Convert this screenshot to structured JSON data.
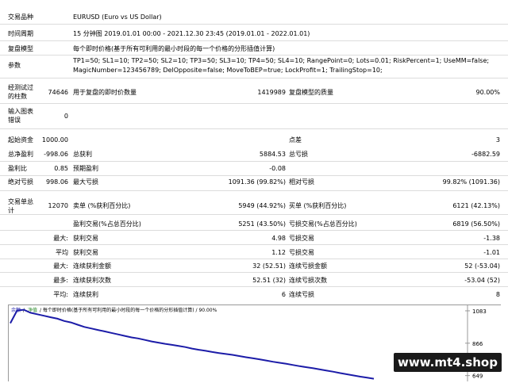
{
  "header": {
    "symbol_label": "交易品种",
    "symbol_value": "EURUSD (Euro vs US Dollar)",
    "period_label": "时间周期",
    "period_value": "15 分钟图 2019.01.01 00:00 - 2021.12.30 23:45 (2019.01.01 - 2022.01.01)",
    "model_label": "复盘模型",
    "model_value": "每个即时价格(基于所有可利用的最小时段的每一个价格的分形插值计算)",
    "params_label": "参数",
    "params_line1": "TP1=50; SL1=10; TP2=50; SL2=10; TP3=50; SL3=10; TP4=50; SL4=10; RangePoint=0; Lots=0.01; RiskPercent=1; UseMM=false;",
    "params_line2": "MagicNumber=123456789; DelOpposite=false; MoveToBEP=true; LockProfit=1; TrailingStop=10;"
  },
  "bars_section": {
    "bars_label_1": "经测试过",
    "bars_label_2": "的柱数",
    "bars_value": "74646",
    "ticks_label": "用于复盘的即时价数量",
    "ticks_value": "1419989",
    "quality_label": "复盘模型的质量",
    "quality_value": "90.00%",
    "errors_label_1": "输入图表",
    "errors_label_2": "错误",
    "errors_value": "0"
  },
  "money": {
    "deposit_label": "起始资金",
    "deposit_value": "1000.00",
    "spread_label": "点差",
    "spread_value": "3",
    "net_label": "总净盈利",
    "net_value": "-998.06",
    "gross_profit_label": "总获利",
    "gross_profit_value": "5884.53",
    "gross_loss_label": "总亏损",
    "gross_loss_value": "-6882.59",
    "pf_label": "盈利比",
    "pf_value": "0.85",
    "payoff_label": "预期盈利",
    "payoff_value": "-0.08",
    "abs_dd_label": "绝对亏损",
    "abs_dd_value": "998.06",
    "max_dd_label": "最大亏损",
    "max_dd_value": "1091.36 (99.82%)",
    "rel_dd_label": "相对亏损",
    "rel_dd_value": "99.82% (1091.36)"
  },
  "trades": {
    "total_label_1": "交易单总",
    "total_label_2": "计",
    "total_value": "12070",
    "short_label": "卖单 (%获利百分比)",
    "short_value": "5949 (44.92%)",
    "long_label": "买单 (%获利百分比)",
    "long_value": "6121 (42.13%)",
    "profit_trades_label": "盈利交易(%占总百分比)",
    "profit_trades_value": "5251 (43.50%)",
    "loss_trades_label": "亏损交易(%占总百分比)",
    "loss_trades_value": "6819 (56.50%)",
    "rows": [
      {
        "pre": "最大:",
        "l1": "获利交易",
        "v1": "4.98",
        "l2": "亏损交易",
        "v2": "-1.38"
      },
      {
        "pre": "平均",
        "l1": "获利交易",
        "v1": "1.12",
        "l2": "亏损交易",
        "v2": "-1.01"
      },
      {
        "pre": "最大:",
        "l1": "连续获利金额",
        "v1": "32 (52.51)",
        "l2": "连续亏损金额",
        "v2": "52 (-53.04)"
      },
      {
        "pre": "最多:",
        "l1": "连续获利次数",
        "v1": "52.51 (32)",
        "l2": "连续亏损次数",
        "v2": "-53.04 (52)"
      },
      {
        "pre": "平均:",
        "l1": "连续获利",
        "v1": "6",
        "l2": "连续亏损",
        "v2": "8"
      }
    ]
  },
  "chart": {
    "balance_label": "余额",
    "sep": "/",
    "equity_label": "净值",
    "model_note": "/ 每个即时价格(基于所有可利用的最小时段的每一个价格的分形插值计算) / 90.00%",
    "axis_ticks": [
      "1083",
      "866",
      "649"
    ],
    "line_color": "#1c1ca8"
  },
  "chart_data": {
    "type": "line",
    "title": "",
    "xlabel": "",
    "ylabel": "",
    "ylim": [
      610,
      1120
    ],
    "y_ticks": [
      1083,
      866,
      649
    ],
    "series": [
      {
        "values": [
          1000,
          1085,
          1090,
          1070,
          1060,
          1050,
          1040,
          1030,
          1015,
          1005,
          990,
          975,
          965,
          955,
          945,
          935,
          925,
          915,
          905,
          898,
          888,
          878,
          870,
          862,
          855,
          848,
          840,
          830,
          822,
          815,
          807,
          800,
          794,
          788,
          780,
          772,
          765,
          758,
          750,
          742,
          735,
          728,
          720,
          712,
          705,
          698,
          690,
          682,
          675,
          666,
          658,
          650,
          642,
          635,
          628
        ]
      }
    ]
  },
  "watermark": "www.mt4.shop"
}
